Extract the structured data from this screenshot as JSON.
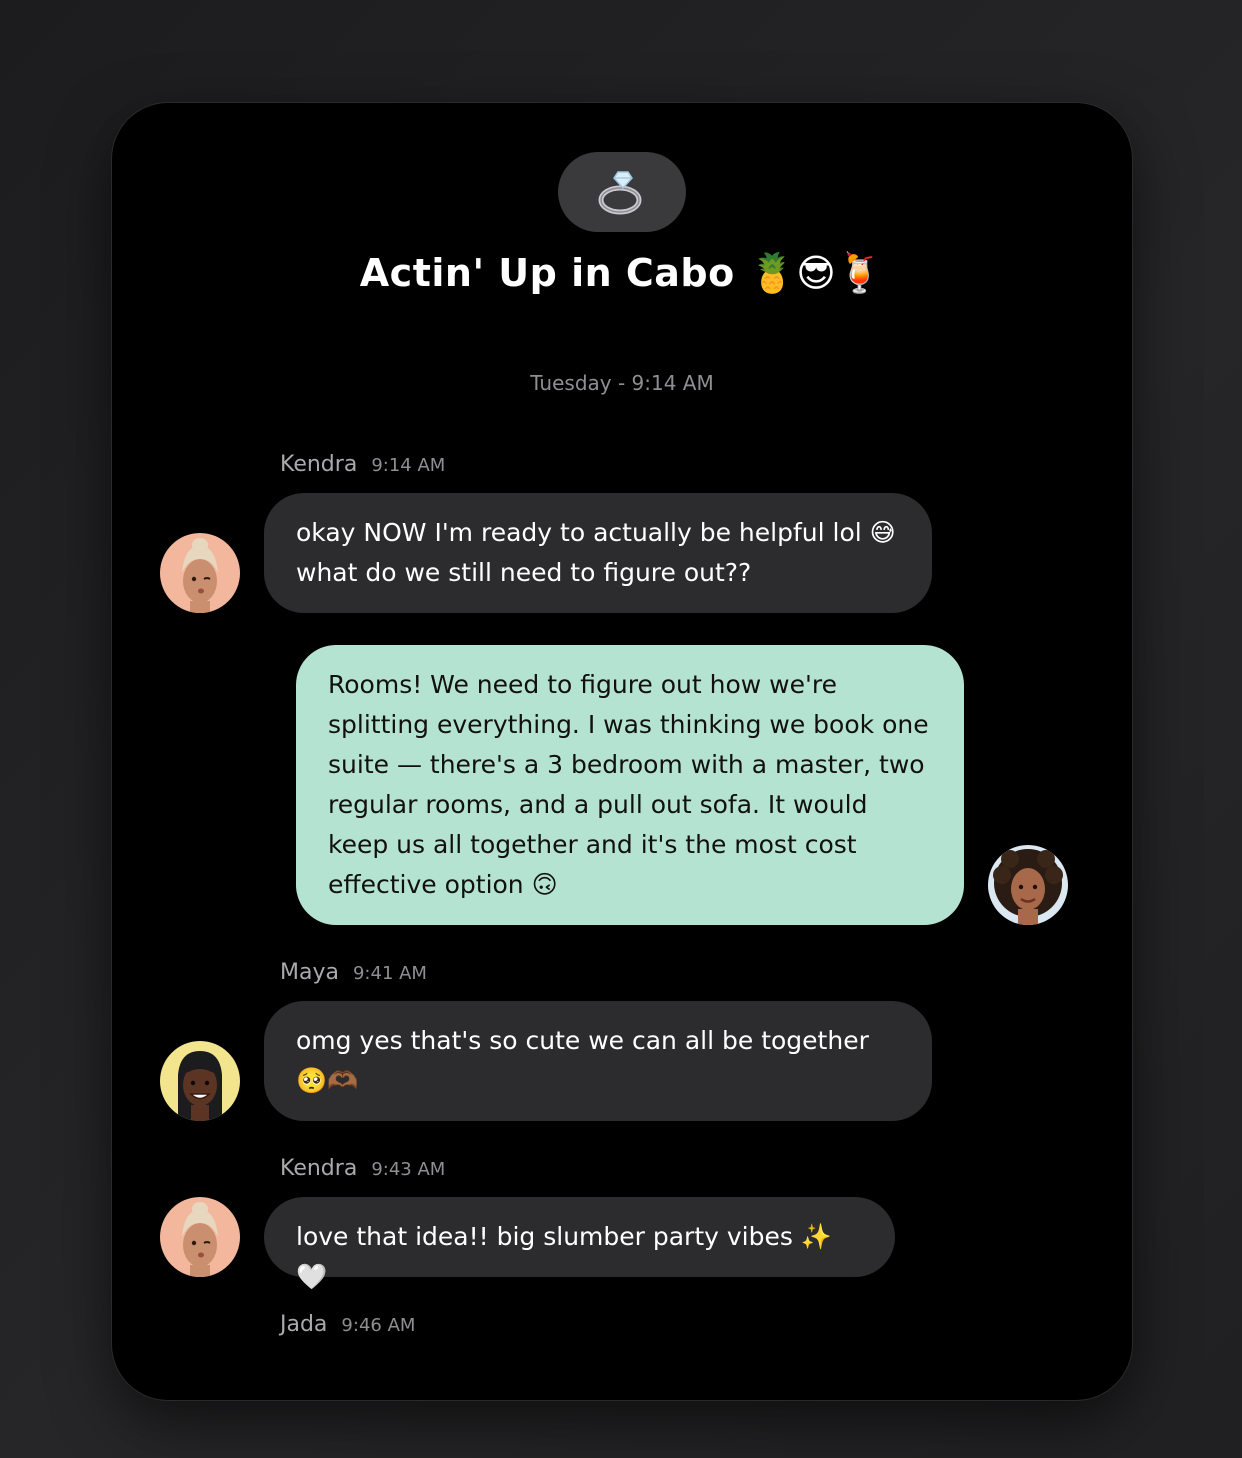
{
  "header": {
    "group_icon": "ring-icon",
    "title": "Actin' Up in Cabo 🍍😎🍹"
  },
  "date_separator": "Tuesday - 9:14 AM",
  "messages": [
    {
      "sender": "Kendra",
      "time": "9:14 AM",
      "text": "okay NOW I'm ready to actually be helpful lol 😅 what do we still need to figure out??",
      "avatar": "kendra-avatar"
    },
    {
      "sender": "",
      "time": "",
      "text": "Rooms! We need to figure out how we're splitting everything. I was thinking we book one suite — there's a 3 bedroom with a master, two regular rooms, and a pull out sofa. It would keep us all together and it's the most cost effective option 🙃",
      "avatar": "self-avatar"
    },
    {
      "sender": "Maya",
      "time": "9:41 AM",
      "text": "omg yes that's so cute we can all be together 🥺🫶🏾",
      "avatar": "maya-avatar"
    },
    {
      "sender": "Kendra",
      "time": "9:43 AM",
      "text": "love that idea!! big slumber party vibes ✨🤍",
      "avatar": "kendra-avatar"
    },
    {
      "sender": "Jada",
      "time": "9:46 AM"
    }
  ],
  "colors": {
    "background": "#222224",
    "card": "#000000",
    "incoming_bubble": "#2c2c2e",
    "outgoing_bubble": "#b5e3d1",
    "meta_text": "#8e8e93"
  }
}
